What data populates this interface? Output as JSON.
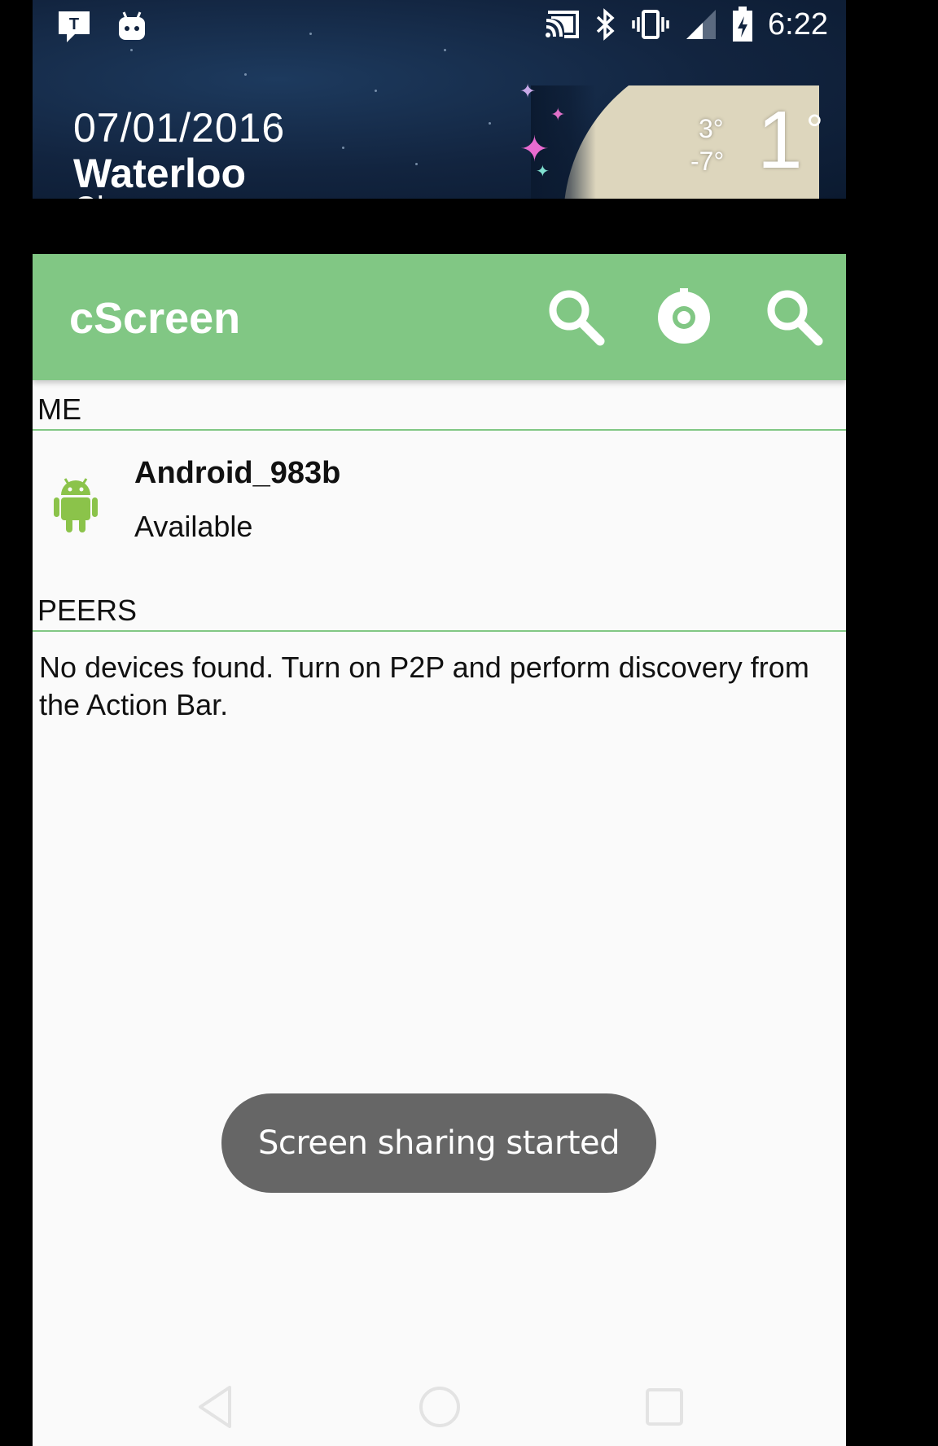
{
  "status_bar": {
    "time": "6:22",
    "left_icons": [
      "t-notification-icon",
      "android-debug-icon"
    ],
    "right_icons": [
      "cast-icon",
      "bluetooth-icon",
      "vibrate-icon",
      "signal-icon",
      "battery-charging-icon"
    ]
  },
  "weather": {
    "date": "07/01/2016",
    "city": "Waterloo",
    "condition": "Clear",
    "temp_current": "1",
    "temp_degree": "°",
    "temp_high": "3°",
    "temp_low": "-7°"
  },
  "app": {
    "title": "cScreen",
    "actions": [
      "search-icon",
      "settings-icon",
      "search-icon"
    ],
    "sections": {
      "me": {
        "header": "ME",
        "device_name": "Android_983b",
        "device_status": "Available"
      },
      "peers": {
        "header": "PEERS",
        "empty_message": "No devices found. Turn on P2P and perform discovery from the Action Bar."
      }
    },
    "toast": "Screen sharing started",
    "accent_color": "#81c784"
  },
  "nav_bar": {
    "buttons": [
      "back-icon",
      "home-icon",
      "recents-icon"
    ]
  }
}
